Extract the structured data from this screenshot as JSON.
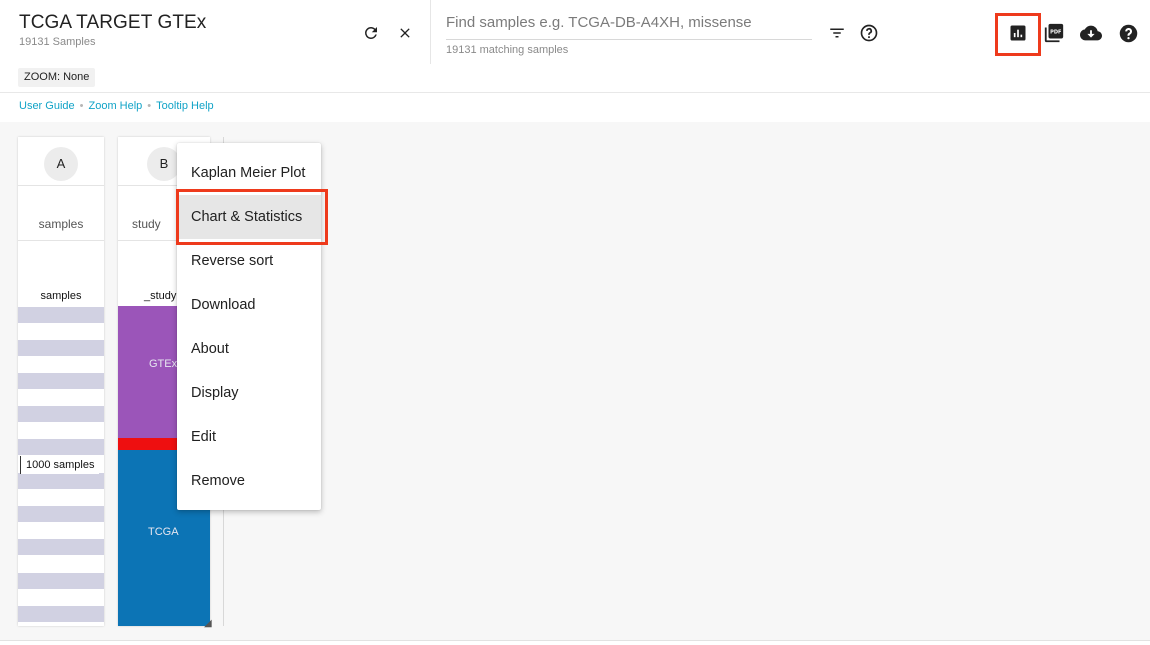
{
  "header": {
    "title": "TCGA TARGET GTEx",
    "subtitle": "19131 Samples",
    "search_placeholder": "Find samples e.g. TCGA-DB-A4XH, missense",
    "match_count": "19131 matching samples",
    "icons": [
      "refresh-icon",
      "close-icon",
      "filter-icon",
      "help-circle-icon",
      "chart-icon",
      "pdf-icon",
      "cloud-download-icon",
      "help-icon"
    ]
  },
  "zoom": {
    "label": "ZOOM: None"
  },
  "links": [
    "User Guide",
    "Zoom Help",
    "Tooltip Help"
  ],
  "columns": [
    {
      "letter": "A",
      "title": "samples",
      "subtitle": "samples",
      "tooltip": "1000 samples"
    },
    {
      "letter": "B",
      "title": "study",
      "subtitle": "_study",
      "segments": [
        "GTEx",
        "TCGA"
      ]
    }
  ],
  "menu": {
    "items": [
      "Kaplan Meier Plot",
      "Chart & Statistics",
      "Reverse sort",
      "Download",
      "About",
      "Display",
      "Edit",
      "Remove"
    ],
    "active": "Chart & Statistics"
  },
  "colors": {
    "gtex": "#9b55b9",
    "target": "#ee0f10",
    "tcga": "#0c74b5",
    "stripe": "#d1d1e2",
    "highlight": "#ee3a1c",
    "link": "#11a3c7"
  }
}
